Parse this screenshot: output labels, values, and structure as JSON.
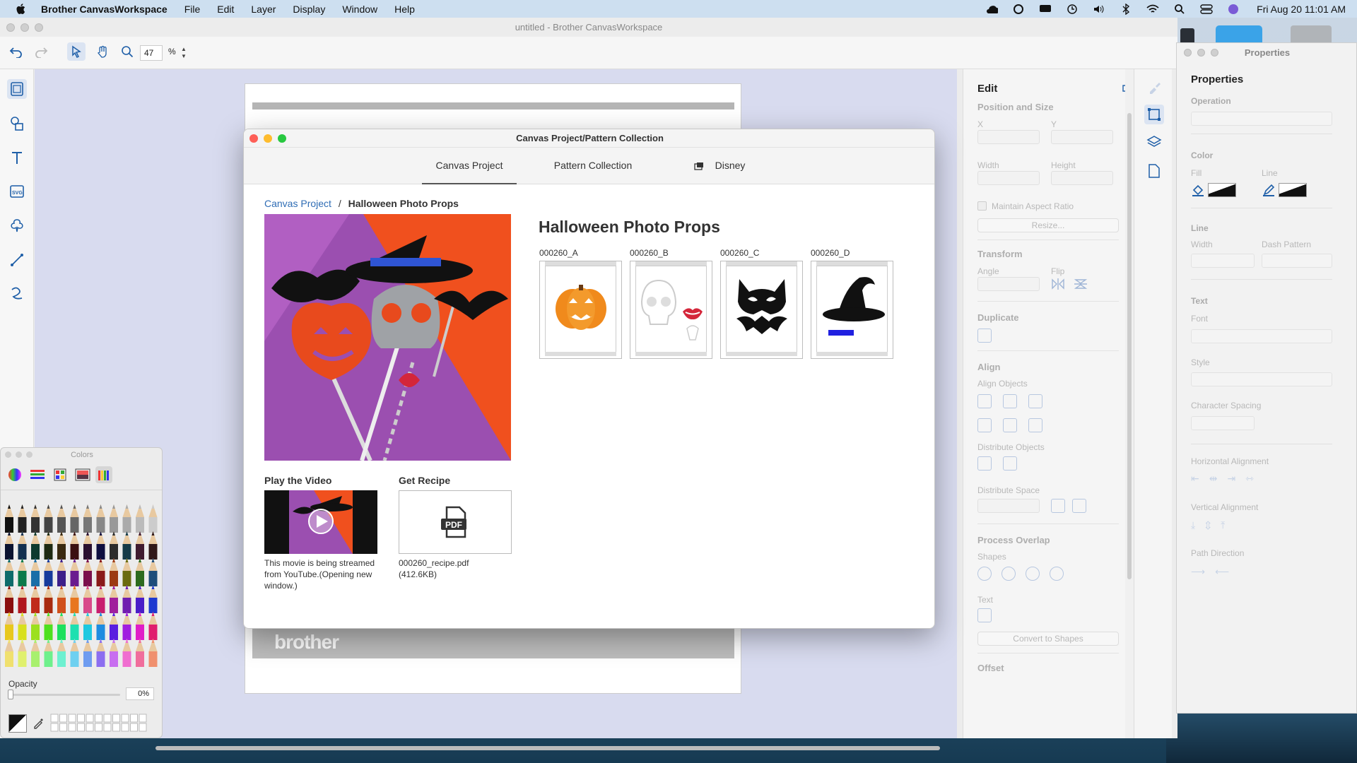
{
  "menubar": {
    "app_name": "Brother CanvasWorkspace",
    "items": [
      "File",
      "Edit",
      "Layer",
      "Display",
      "Window",
      "Help"
    ],
    "clock": "Fri Aug 20  11:01 AM"
  },
  "window": {
    "title": "untitled - Brother CanvasWorkspace",
    "zoom_value": "47",
    "zoom_unit": "%"
  },
  "canvas": {
    "brand_text": "brother"
  },
  "dialog": {
    "title": "Canvas Project/Pattern Collection",
    "tabs": [
      {
        "label": "Canvas Project",
        "selected": true
      },
      {
        "label": "Pattern Collection",
        "selected": false
      },
      {
        "label": "Disney",
        "selected": false
      }
    ],
    "breadcrumb": {
      "link": "Canvas Project",
      "separator": "/",
      "current": "Halloween Photo Props"
    },
    "project_title": "Halloween Photo Props",
    "patterns": [
      {
        "code": "000260_A",
        "icon": "pumpkin-icon"
      },
      {
        "code": "000260_B",
        "icon": "skull-icon"
      },
      {
        "code": "000260_C",
        "icon": "bat-mask-icon"
      },
      {
        "code": "000260_D",
        "icon": "witch-hat-icon"
      }
    ],
    "video": {
      "label": "Play the Video",
      "note": "This movie is being streamed from YouTube.(Opening new window.)"
    },
    "recipe": {
      "label": "Get Recipe",
      "icon_text": "PDF",
      "file_name": "000260_recipe.pdf",
      "file_size": "(412.6KB)"
    }
  },
  "edit_panel": {
    "title": "Edit",
    "position_size": {
      "section": "Position and Size",
      "x": "X",
      "y": "Y",
      "width": "Width",
      "height": "Height",
      "maintain_ratio": "Maintain Aspect Ratio",
      "resize": "Resize..."
    },
    "transform": {
      "section": "Transform",
      "angle": "Angle",
      "flip": "Flip"
    },
    "duplicate": {
      "section": "Duplicate"
    },
    "align": {
      "section": "Align",
      "align_objects": "Align Objects",
      "distribute_objects": "Distribute Objects",
      "distribute_space": "Distribute Space"
    },
    "process_overlap": {
      "section": "Process Overlap",
      "shapes": "Shapes",
      "text": "Text",
      "convert": "Convert to Shapes"
    },
    "offset": {
      "section": "Offset"
    }
  },
  "properties": {
    "window_title": "Properties",
    "title": "Properties",
    "operation": "Operation",
    "color": {
      "section": "Color",
      "fill": "Fill",
      "line": "Line"
    },
    "line": {
      "section": "Line",
      "width": "Width",
      "dash": "Dash Pattern"
    },
    "text": {
      "section": "Text",
      "font": "Font",
      "style": "Style",
      "char_spacing": "Character Spacing"
    },
    "h_align": "Horizontal Alignment",
    "v_align": "Vertical Alignment",
    "path_direction": "Path Direction"
  },
  "colors_panel": {
    "title": "Colors",
    "opacity_label": "Opacity",
    "opacity_value": "0%"
  },
  "colors": {
    "accent": "#2f6db5",
    "pumpkin": "#f08a1c",
    "hero_orange": "#f0501e",
    "hero_purple": "#9b4fb0"
  }
}
